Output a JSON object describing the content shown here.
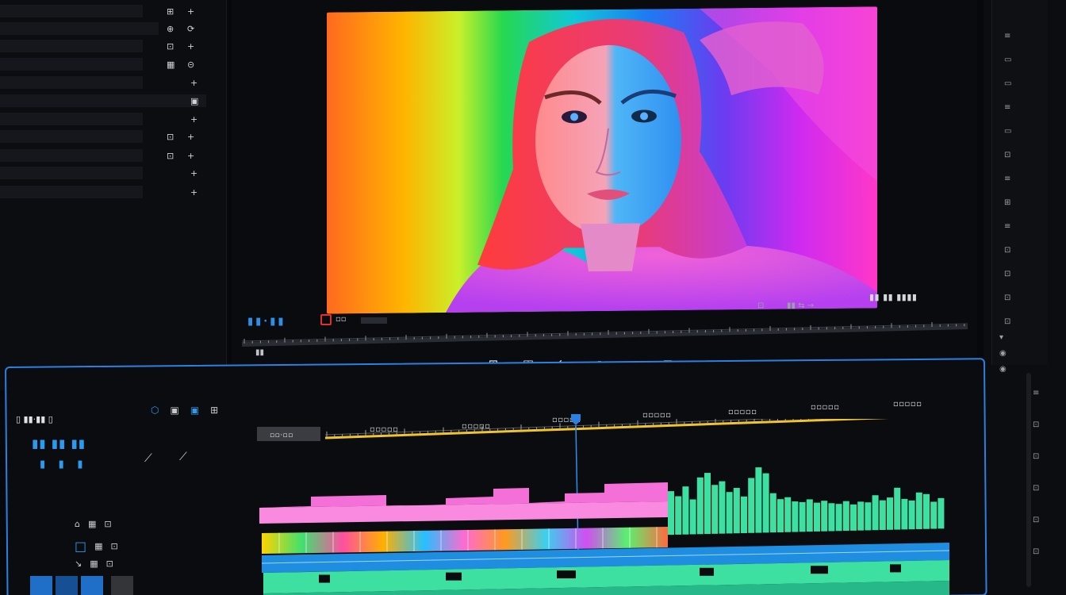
{
  "project_panel": {
    "rows": [
      {
        "label": "",
        "icons": [
          "⊞",
          "+"
        ]
      },
      {
        "label": "",
        "icons": [
          "⊕",
          "⟳"
        ]
      },
      {
        "label": "",
        "icons": [
          "⊡",
          "+"
        ]
      },
      {
        "label": "",
        "icons": [
          "▦",
          "⊝"
        ]
      },
      {
        "label": "",
        "icons": [
          "+"
        ]
      },
      {
        "label": "",
        "icons": [
          "▣"
        ]
      },
      {
        "label": "",
        "icons": [
          "+"
        ]
      },
      {
        "label": "",
        "icons": [
          "⊡",
          "+"
        ]
      },
      {
        "label": "",
        "icons": [
          "⊡",
          "+"
        ]
      },
      {
        "label": "",
        "icons": [
          "+"
        ]
      },
      {
        "label": "",
        "icons": [
          "+"
        ]
      }
    ],
    "footer_icons": [
      "■",
      "+"
    ]
  },
  "monitor": {
    "transport_icons": [
      "⊞",
      "◫",
      "⇆",
      "↗",
      "↘",
      "⊡",
      "◈",
      "◧",
      "↶"
    ]
  },
  "right_strip": {
    "icons": [
      "≡",
      "▭",
      "▭",
      "≡",
      "▭",
      "⊡",
      "≡",
      "⊞",
      "≡",
      "⊡",
      "⊡",
      "⊡",
      "⊡",
      "▾",
      "◉",
      "◉",
      "≡",
      "⊡",
      "⊡",
      "⊡",
      "⊡",
      "⊡"
    ]
  },
  "timeline": {
    "tool_icons": [
      "⬡",
      "▣",
      "▣",
      "⊞"
    ],
    "track_rows": [
      {
        "icons": [
          "⌂",
          "▦",
          "⊡"
        ]
      },
      {
        "icons": [
          "□",
          "▦",
          "⊡"
        ]
      },
      {
        "icons": [
          "↘",
          "▦",
          "⊡"
        ]
      }
    ]
  },
  "colors": {
    "accent_blue": "#2d7fe0",
    "audio_green": "#3de0a0",
    "clip_pink": "#f46ad8",
    "record_red": "#e0302c"
  }
}
